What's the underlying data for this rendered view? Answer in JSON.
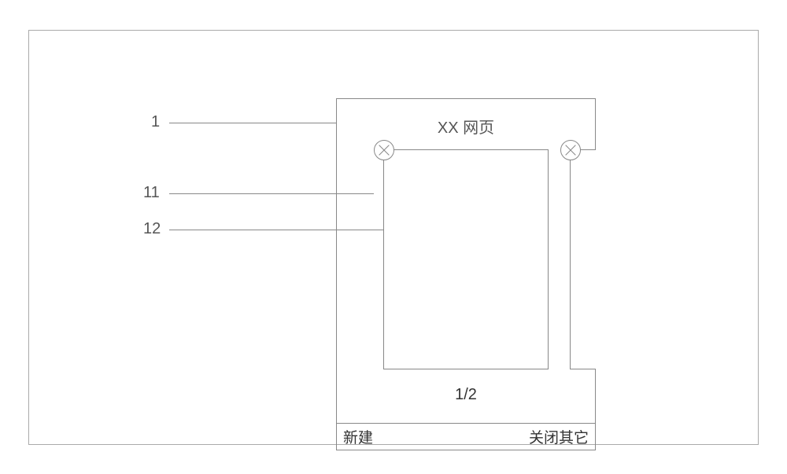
{
  "labels": {
    "ref1": "1",
    "ref11": "11",
    "ref12": "12"
  },
  "phone": {
    "title": "XX 网页",
    "pageCounter": "1/2",
    "bottomBar": {
      "newButton": "新建",
      "closeOthersButton": "关闭其它"
    }
  }
}
